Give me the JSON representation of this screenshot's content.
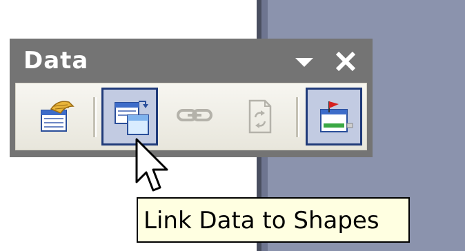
{
  "toolbar": {
    "title": "Data",
    "dropdown_icon": "triangle-down-icon",
    "close_icon": "close-icon",
    "buttons": [
      {
        "name": "data-source-icon",
        "state": "normal"
      },
      {
        "name": "link-data-to-shapes-icon",
        "state": "active"
      },
      {
        "name": "link-chain-icon",
        "state": "disabled"
      },
      {
        "name": "refresh-data-icon",
        "state": "disabled"
      },
      {
        "name": "insert-data-graphic-icon",
        "state": "active"
      }
    ]
  },
  "tooltip": {
    "text": "Link Data to Shapes"
  },
  "colors": {
    "title_bar": "#747474",
    "active_button_fill": "#c2cbe2",
    "active_button_border": "#1f3a79",
    "tooltip_bg": "#ffffe1",
    "right_panel": "#8b93ad"
  }
}
